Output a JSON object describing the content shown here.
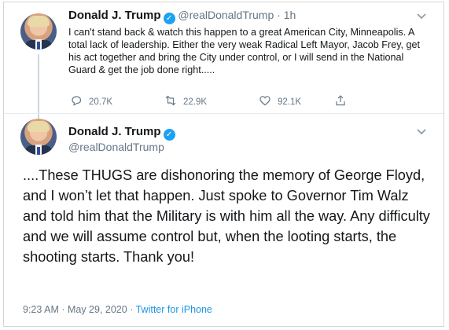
{
  "tweet1": {
    "name": "Donald J. Trump",
    "handle": "@realDonaldTrump",
    "separator": "·",
    "time": "1h",
    "text": "I can't stand back & watch this happen to a great American City, Minneapolis. A total lack of leadership. Either the very weak Radical Left Mayor, Jacob Frey, get his act together and bring the City under control, or I will send in the National Guard & get the job done right.....",
    "replies": "20.7K",
    "retweets": "22.9K",
    "likes": "92.1K"
  },
  "tweet2": {
    "name": "Donald J. Trump",
    "handle": "@realDonaldTrump",
    "text": "....These THUGS are dishonoring the memory of George Floyd, and I won’t let that happen. Just spoke to Governor Tim Walz and told him that the Military is with him all the way. Any difficulty and we will assume control but, when the looting starts, the shooting starts. Thank you!",
    "timestamp": "9:23 AM · May 29, 2020 ·",
    "source": "Twitter for iPhone"
  },
  "icons": {
    "verified": "verified-badge-icon",
    "more": "chevron-down-icon",
    "reply": "reply-icon",
    "retweet": "retweet-icon",
    "like": "heart-icon",
    "share": "share-icon"
  },
  "colors": {
    "accent": "#1da1f2",
    "link": "#1b95e0",
    "muted": "#657786"
  }
}
